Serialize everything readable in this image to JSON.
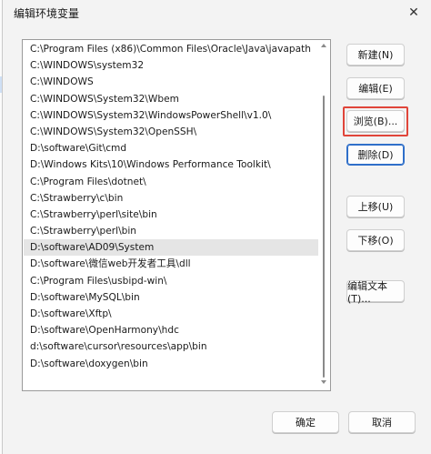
{
  "dialog": {
    "title": "编辑环境变量",
    "close_glyph": "✕"
  },
  "path_list": [
    "C:\\Program Files (x86)\\Common Files\\Oracle\\Java\\javapath",
    "C:\\WINDOWS\\system32",
    "C:\\WINDOWS",
    "C:\\WINDOWS\\System32\\Wbem",
    "C:\\WINDOWS\\System32\\WindowsPowerShell\\v1.0\\",
    "C:\\WINDOWS\\System32\\OpenSSH\\",
    "D:\\software\\Git\\cmd",
    "D:\\Windows Kits\\10\\Windows Performance Toolkit\\",
    "C:\\Program Files\\dotnet\\",
    "C:\\Strawberry\\c\\bin",
    "C:\\Strawberry\\perl\\site\\bin",
    "C:\\Strawberry\\perl\\bin",
    "D:\\software\\AD09\\System",
    "D:\\software\\微信web开发者工具\\dll",
    "C:\\Program Files\\usbipd-win\\",
    "D:\\software\\MySQL\\bin",
    "D:\\software\\Xftp\\",
    "D:\\software\\OpenHarmony\\hdc",
    "d:\\software\\cursor\\resources\\app\\bin",
    "D:\\software\\doxygen\\bin"
  ],
  "hovered_index": 12,
  "buttons": {
    "new": "新建(N)",
    "edit": "编辑(E)",
    "browse": "浏览(B)...",
    "delete": "删除(D)",
    "move_up": "上移(U)",
    "move_down": "下移(O)",
    "edit_text": "编辑文本(T)...",
    "ok": "确定",
    "cancel": "取消"
  },
  "colors": {
    "highlight_frame": "#e0453a",
    "focus_border": "#2f6fc9",
    "hover_row": "#e5e5e5"
  }
}
